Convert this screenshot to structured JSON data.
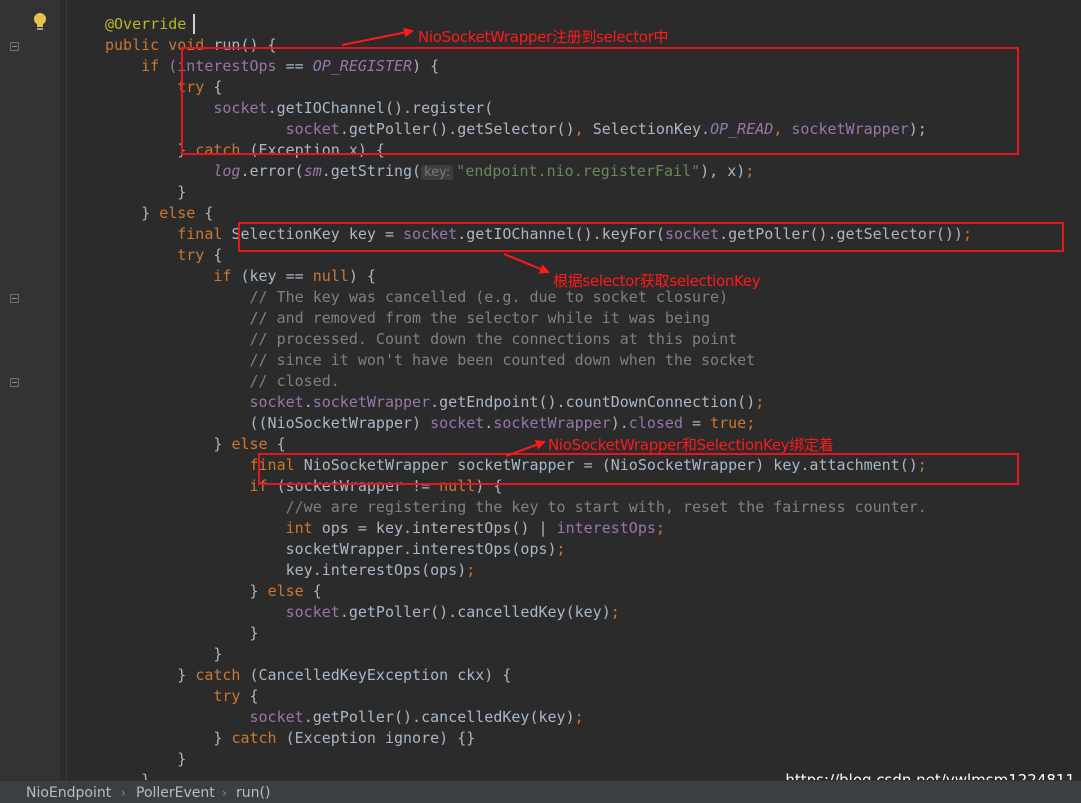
{
  "editor": {
    "lines": [
      [
        {
          "t": "@Override",
          "c": "ann"
        }
      ],
      [
        {
          "t": "public void ",
          "c": "kw"
        },
        {
          "t": "run() {",
          "c": "plain"
        }
      ],
      [
        {
          "t": "    if ",
          "c": "kw"
        },
        {
          "t": "(interestOps",
          "c": "field"
        },
        {
          "t": " == ",
          "c": "plain"
        },
        {
          "t": "OP_REGISTER",
          "c": "cnst"
        },
        {
          "t": ") {",
          "c": "plain"
        }
      ],
      [
        {
          "t": "        try ",
          "c": "kw"
        },
        {
          "t": "{",
          "c": "plain"
        }
      ],
      [
        {
          "t": "            socket",
          "c": "field"
        },
        {
          "t": ".getIOChannel().register(",
          "c": "plain"
        }
      ],
      [
        {
          "t": "                    socket",
          "c": "field"
        },
        {
          "t": ".getPoller().getSelector()",
          "c": "plain"
        },
        {
          "t": ", ",
          "c": "kw"
        },
        {
          "t": "SelectionKey.",
          "c": "plain"
        },
        {
          "t": "OP_READ",
          "c": "cnst"
        },
        {
          "t": ", ",
          "c": "kw"
        },
        {
          "t": "socketWrapper",
          "c": "field"
        },
        {
          "t": ");",
          "c": "plain"
        }
      ],
      [
        {
          "t": "        } ",
          "c": "plain"
        },
        {
          "t": "catch ",
          "c": "kw"
        },
        {
          "t": "(Exception x) {",
          "c": "plain"
        }
      ],
      [
        {
          "t": "            ",
          "c": "plain"
        },
        {
          "t": "log",
          "c": "cnst"
        },
        {
          "t": ".error(",
          "c": "plain"
        },
        {
          "t": "sm",
          "c": "cnst"
        },
        {
          "t": ".getString(",
          "c": "plain"
        },
        {
          "t": "key:",
          "c": "hint"
        },
        {
          "t": "\"endpoint.nio.registerFail\"",
          "c": "str"
        },
        {
          "t": "), x)",
          "c": "plain"
        },
        {
          "t": ";",
          "c": "kw"
        }
      ],
      [
        {
          "t": "        }",
          "c": "plain"
        }
      ],
      [
        {
          "t": "    } ",
          "c": "plain"
        },
        {
          "t": "else ",
          "c": "kw"
        },
        {
          "t": "{",
          "c": "plain"
        }
      ],
      [
        {
          "t": "        final ",
          "c": "kw"
        },
        {
          "t": "SelectionKey key = ",
          "c": "plain"
        },
        {
          "t": "socket",
          "c": "field"
        },
        {
          "t": ".getIOChannel().keyFor(",
          "c": "plain"
        },
        {
          "t": "socket",
          "c": "field"
        },
        {
          "t": ".getPoller().getSelector())",
          "c": "plain"
        },
        {
          "t": ";",
          "c": "kw"
        }
      ],
      [
        {
          "t": "        try ",
          "c": "kw"
        },
        {
          "t": "{",
          "c": "plain"
        }
      ],
      [
        {
          "t": "            if ",
          "c": "kw"
        },
        {
          "t": "(key == ",
          "c": "plain"
        },
        {
          "t": "null",
          "c": "kw"
        },
        {
          "t": ") {",
          "c": "plain"
        }
      ],
      [
        {
          "t": "                // The key was cancelled (e.g. due to socket closure)",
          "c": "cmt"
        }
      ],
      [
        {
          "t": "                // and removed from the selector while it was being",
          "c": "cmt"
        }
      ],
      [
        {
          "t": "                // processed. Count down the connections at this point",
          "c": "cmt"
        }
      ],
      [
        {
          "t": "                // since it won't have been counted down when the socket",
          "c": "cmt"
        }
      ],
      [
        {
          "t": "                // closed.",
          "c": "cmt"
        }
      ],
      [
        {
          "t": "                socket",
          "c": "field"
        },
        {
          "t": ".",
          "c": "plain"
        },
        {
          "t": "socketWrapper",
          "c": "field"
        },
        {
          "t": ".getEndpoint().countDownConnection()",
          "c": "plain"
        },
        {
          "t": ";",
          "c": "kw"
        }
      ],
      [
        {
          "t": "                ((NioSocketWrapper) ",
          "c": "plain"
        },
        {
          "t": "socket",
          "c": "field"
        },
        {
          "t": ".",
          "c": "plain"
        },
        {
          "t": "socketWrapper",
          "c": "field"
        },
        {
          "t": ").",
          "c": "plain"
        },
        {
          "t": "closed",
          "c": "field"
        },
        {
          "t": " = ",
          "c": "plain"
        },
        {
          "t": "true;",
          "c": "kw"
        }
      ],
      [
        {
          "t": "            } ",
          "c": "plain"
        },
        {
          "t": "else ",
          "c": "kw"
        },
        {
          "t": "{",
          "c": "plain"
        }
      ],
      [
        {
          "t": "                final ",
          "c": "kw"
        },
        {
          "t": "NioSocketWrapper socketWrapper = (NioSocketWrapper) key.attachment()",
          "c": "plain"
        },
        {
          "t": ";",
          "c": "kw"
        }
      ],
      [
        {
          "t": "                if ",
          "c": "kw"
        },
        {
          "t": "(socketWrapper != ",
          "c": "plain"
        },
        {
          "t": "null",
          "c": "kw"
        },
        {
          "t": ") {",
          "c": "plain"
        }
      ],
      [
        {
          "t": "                    //we are registering the key to start with, reset the fairness counter.",
          "c": "cmt"
        }
      ],
      [
        {
          "t": "                    int ",
          "c": "kw"
        },
        {
          "t": "ops = key.interestOps() | ",
          "c": "plain"
        },
        {
          "t": "interestOps",
          "c": "field"
        },
        {
          "t": ";",
          "c": "kw"
        }
      ],
      [
        {
          "t": "                    socketWrapper.interestOps(ops)",
          "c": "plain"
        },
        {
          "t": ";",
          "c": "kw"
        }
      ],
      [
        {
          "t": "                    key.interestOps(ops)",
          "c": "plain"
        },
        {
          "t": ";",
          "c": "kw"
        }
      ],
      [
        {
          "t": "                } ",
          "c": "plain"
        },
        {
          "t": "else ",
          "c": "kw"
        },
        {
          "t": "{",
          "c": "plain"
        }
      ],
      [
        {
          "t": "                    socket",
          "c": "field"
        },
        {
          "t": ".getPoller().cancelledKey(key)",
          "c": "plain"
        },
        {
          "t": ";",
          "c": "kw"
        }
      ],
      [
        {
          "t": "                }",
          "c": "plain"
        }
      ],
      [
        {
          "t": "            }",
          "c": "plain"
        }
      ],
      [
        {
          "t": "        } ",
          "c": "plain"
        },
        {
          "t": "catch ",
          "c": "kw"
        },
        {
          "t": "(CancelledKeyException ckx) {",
          "c": "plain"
        }
      ],
      [
        {
          "t": "            try ",
          "c": "kw"
        },
        {
          "t": "{",
          "c": "plain"
        }
      ],
      [
        {
          "t": "                socket",
          "c": "field"
        },
        {
          "t": ".getPoller().cancelledKey(key)",
          "c": "plain"
        },
        {
          "t": ";",
          "c": "kw"
        }
      ],
      [
        {
          "t": "            } ",
          "c": "plain"
        },
        {
          "t": "catch ",
          "c": "kw"
        },
        {
          "t": "(Exception ignore) {}",
          "c": "plain"
        }
      ],
      [
        {
          "t": "        }",
          "c": "plain"
        }
      ],
      [
        {
          "t": "    }",
          "c": "plain"
        }
      ]
    ]
  },
  "annotations": {
    "register": "NioSocketWrapper注册到selector中",
    "selection_key": "根据selector获取selectionKey",
    "bind": "NioSocketWrapper和SelectionKey绑定着"
  },
  "breadcrumb": [
    "NioEndpoint",
    "PollerEvent",
    "run()"
  ],
  "watermark": "https://blog.csdn.net/ywlmsm1224811",
  "colors": {
    "background": "#2b2b2b",
    "keyword": "#cc7832",
    "annotation_red": "#e5161d"
  }
}
